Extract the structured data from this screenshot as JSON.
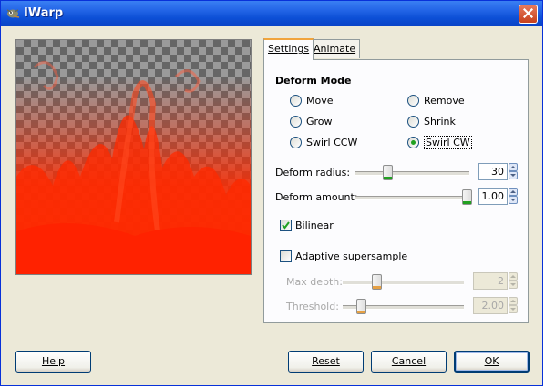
{
  "window": {
    "title": "IWarp"
  },
  "tabs": [
    {
      "label": "Settings",
      "accel_index": 0
    },
    {
      "label": "Animate",
      "accel_index": 0
    }
  ],
  "settings": {
    "deform_mode_title": "Deform Mode",
    "modes": [
      {
        "label": "Move",
        "checked": false
      },
      {
        "label": "Remove",
        "checked": false
      },
      {
        "label": "Grow",
        "checked": false
      },
      {
        "label": "Shrink",
        "checked": false
      },
      {
        "label": "Swirl CCW",
        "checked": false
      },
      {
        "label": "Swirl CW",
        "checked": true
      }
    ],
    "deform_radius": {
      "label": "Deform radius:",
      "value": "30",
      "slider_fraction": 0.25
    },
    "deform_amount": {
      "label": "Deform amount:",
      "value": "1.00",
      "slider_fraction": 1.0
    },
    "bilinear": {
      "label": "Bilinear",
      "checked": true
    },
    "adaptive_supersample": {
      "label": "Adaptive supersample",
      "checked": false
    },
    "max_depth": {
      "label": "Max depth:",
      "value": "2",
      "disabled": true
    },
    "threshold": {
      "label": "Threshold:",
      "value": "2.00",
      "disabled": true
    }
  },
  "buttons": {
    "help": "Help",
    "reset": "Reset",
    "cancel": "Cancel",
    "ok": "OK"
  },
  "colors": {
    "title_bar": "#0c4fd6",
    "flame": "#ff2a00",
    "active_tab_accent": "#f1a43c",
    "radio_check": "#21a121"
  },
  "icons": {
    "app_icon": "gimp-wilber-icon",
    "close": "close-icon"
  }
}
